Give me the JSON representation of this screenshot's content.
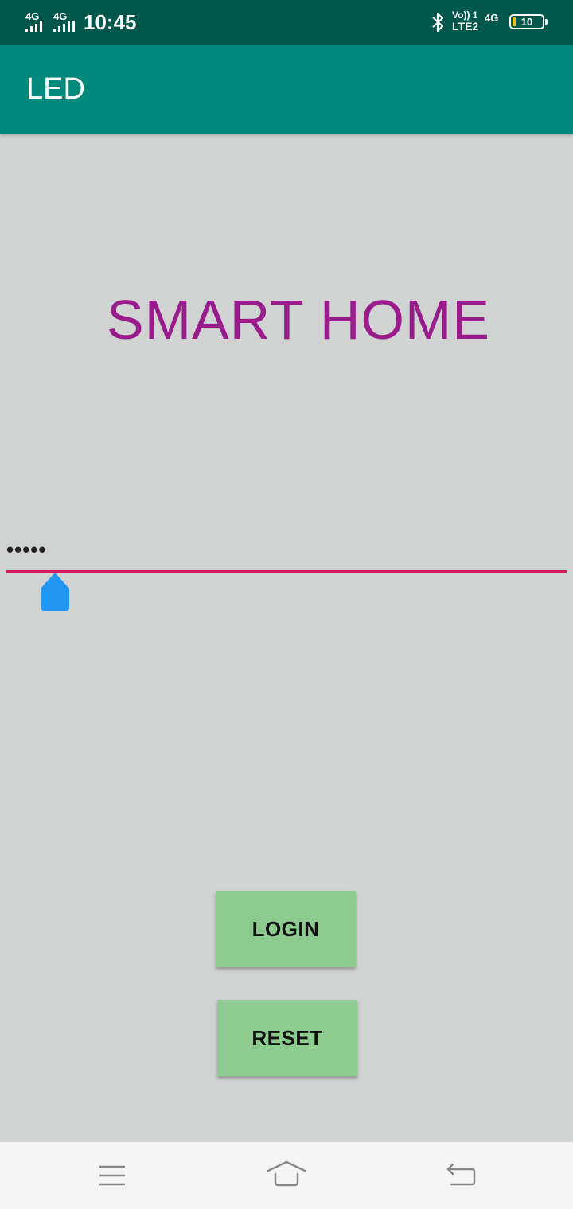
{
  "status_bar": {
    "sim1_network": "4G",
    "sim2_network": "4G",
    "time": "10:45",
    "volte_top": "Vo)) 1",
    "volte_bottom": "LTE2",
    "data_network": "4G",
    "battery_level": "10",
    "icons": [
      "signal-icon",
      "bluetooth-icon",
      "battery-icon"
    ]
  },
  "app_bar": {
    "title": "LED"
  },
  "main": {
    "heading": "SMART HOME",
    "password_field": {
      "value": "•••••"
    },
    "login_button": "LOGIN",
    "reset_button": "RESET"
  },
  "nav_bar": {
    "icons": [
      "menu-icon",
      "home-icon",
      "back-icon"
    ]
  },
  "colors": {
    "status_bar": "#00574b",
    "app_bar": "#00897b",
    "background": "#d1d3d2",
    "heading": "#9a1b8c",
    "underline": "#d81b60",
    "cursor_handle": "#2196f3",
    "button": "#8dcc8e"
  }
}
